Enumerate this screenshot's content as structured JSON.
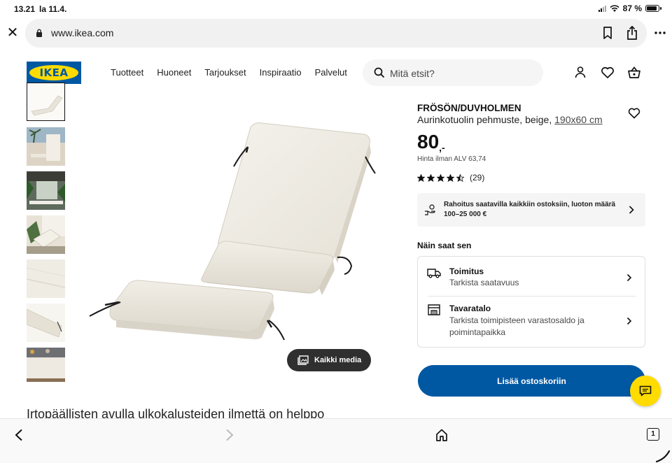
{
  "status_bar": {
    "time": "13.21",
    "date": "la 11.4.",
    "battery": "87 %",
    "battery_level": 0.87
  },
  "browser": {
    "url": "www.ikea.com"
  },
  "header": {
    "logo_text": "IKEA",
    "nav": [
      "Tuotteet",
      "Huoneet",
      "Tarjoukset",
      "Inspiraatio",
      "Palvelut"
    ],
    "search_placeholder": "Mitä etsit?"
  },
  "gallery": {
    "all_media_label": "Kaikki media",
    "thumbnail_count": 7
  },
  "product": {
    "name": "FRÖSÖN/DUVHOLMEN",
    "description": "Aurinkotuolin pehmuste, beige,",
    "size": "190x60 cm",
    "price": "80",
    "price_suffix": ",-",
    "vat_note": "Hinta ilman ALV 63,74",
    "rating": 4.5,
    "reviews": "(29)"
  },
  "finance": {
    "text": "Rahoitus saatavilla kaikkiin ostoksiin, luoton määrä 100–25 000 €"
  },
  "fulfilment": {
    "heading": "Näin saat sen",
    "options": [
      {
        "title": "Toimitus",
        "subtitle": "Tarkista saatavuus"
      },
      {
        "title": "Tavaratalo",
        "subtitle": "Tarkista toimipisteen varastosaldo ja poimintapaikka"
      }
    ]
  },
  "cta": {
    "add_to_cart": "Lisää ostoskoriin"
  },
  "blurb": "Irtopäällisten avulla ulkokalusteiden ilmettä on helppo",
  "colors": {
    "ikea_blue": "#0058a3",
    "ikea_yellow": "#ffdb00",
    "cushion": "#efece4"
  }
}
